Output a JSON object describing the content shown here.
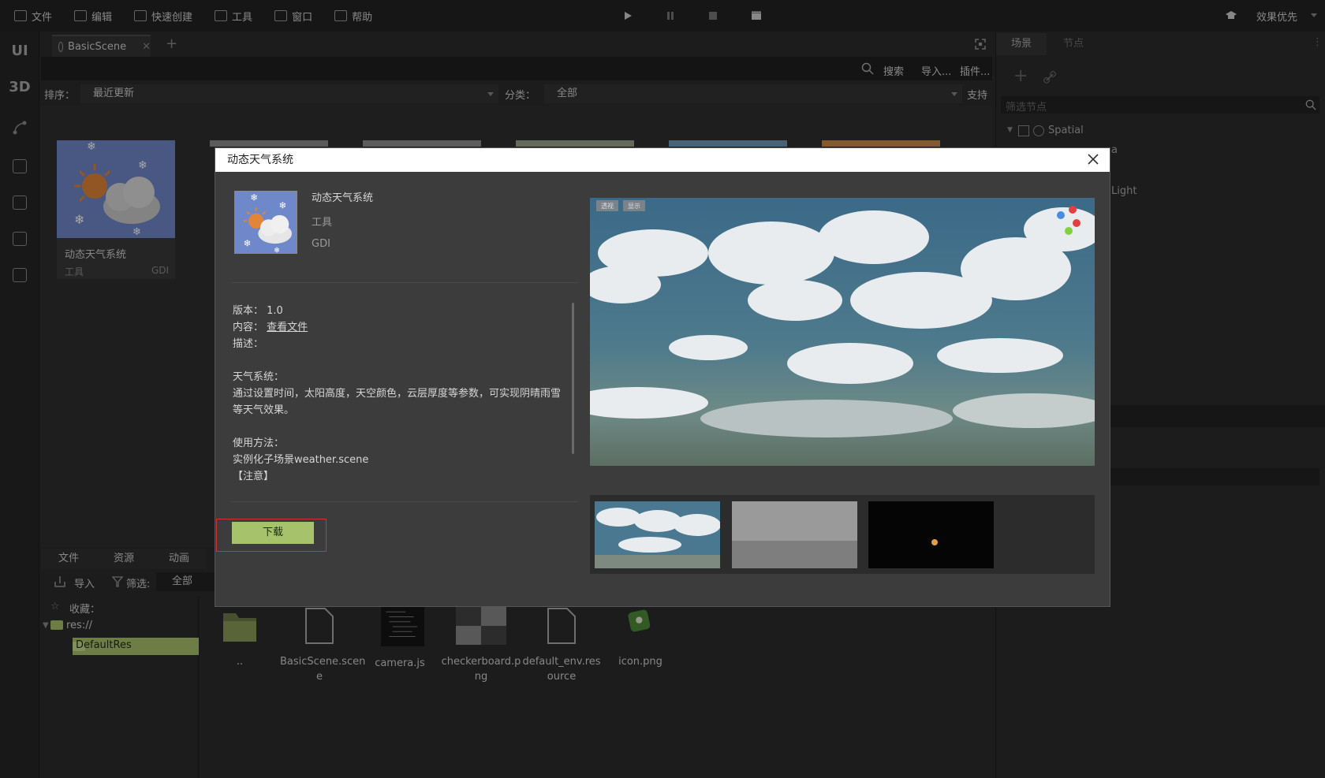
{
  "menubar": {
    "items": [
      {
        "label": "文件",
        "icon": "folder-icon"
      },
      {
        "label": "编辑",
        "icon": "crop-icon"
      },
      {
        "label": "快速创建",
        "icon": "edit-icon"
      },
      {
        "label": "工具",
        "icon": "window-icon"
      },
      {
        "label": "窗口",
        "icon": "frame-icon"
      },
      {
        "label": "帮助",
        "icon": "book-icon"
      }
    ],
    "quality_label": "效果优先"
  },
  "left_toolbar": {
    "ui_label": "UI",
    "3d_label": "3D"
  },
  "scene_tab": {
    "label": "BasicScene"
  },
  "search_bar": {
    "search_label": "搜索",
    "import_label": "导入...",
    "plugin_label": "插件..."
  },
  "sort_bar": {
    "sort_label": "排序：",
    "sort_value": "最近更新",
    "category_label": "分类：",
    "category_value": "全部",
    "support_label": "支持"
  },
  "asset_card": {
    "title": "动态天气系统",
    "category": "工具",
    "author": "GDI"
  },
  "bottom_panel": {
    "tabs": [
      "文件",
      "资源",
      "动画"
    ],
    "import_label": "导入",
    "filter_label": "筛选:",
    "filter_value": "全部",
    "favorites_label": "收藏：",
    "tree_root": "res://",
    "tree_child": "DefaultRes",
    "files": [
      {
        "name": "..",
        "icon": "folder-icon"
      },
      {
        "name": "BasicScene.scene",
        "line1": "BasicScene.scen",
        "line2": "e",
        "icon": "file-icon"
      },
      {
        "name": "camera.js",
        "line1": "camera.js",
        "line2": "",
        "icon": "script-thumb-icon"
      },
      {
        "name": "checkerboard.png",
        "line1": "checkerboard.p",
        "line2": "ng",
        "icon": "checkerboard-icon"
      },
      {
        "name": "default_env.resource",
        "line1": "default_env.res",
        "line2": "ource",
        "icon": "file-icon"
      },
      {
        "name": "icon.png",
        "line1": "icon.png",
        "line2": "",
        "icon": "app-icon"
      }
    ]
  },
  "right_panel": {
    "tab_scene": "场景",
    "tab_node": "节点",
    "filter_placeholder": "筛选节点",
    "root_node": "Spatial",
    "child_a": "a",
    "child_light": "Light"
  },
  "dialog": {
    "title": "动态天气系统",
    "name": "动态天气系统",
    "category": "工具",
    "author": "GDI",
    "version_label": "版本：",
    "version_value": "1.0",
    "content_label": "内容：",
    "content_link": "查看文件",
    "desc_label": "描述：",
    "desc_heading": "天气系统：",
    "desc_line1": "通过设置时间，太阳高度，天空颜色，云层厚度等参数，可实现阴晴雨雪",
    "desc_line2": "等天气效果。",
    "usage_heading": "使用方法：",
    "usage_line": "实例化子场景weather.scene",
    "note_line": "【注意】",
    "download_label": "下载",
    "preview_chip1": "透视",
    "preview_chip2": "显示"
  },
  "colors": {
    "accent_green": "#a6c26a",
    "sky_blue": "#6f88c9",
    "highlight_red": "#d43030"
  }
}
